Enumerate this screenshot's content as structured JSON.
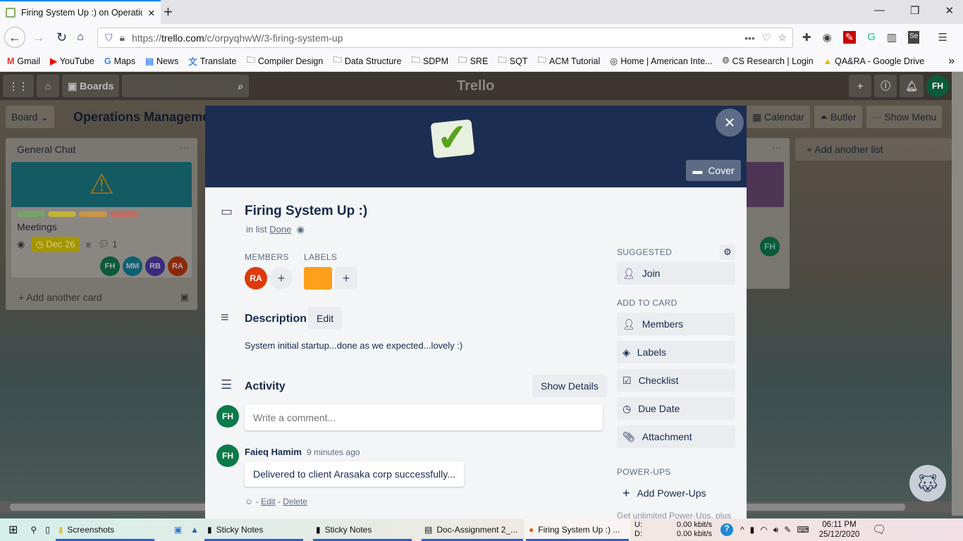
{
  "browser": {
    "tab_title": "Firing System Up :) on Operatio",
    "url_prefix": "https://",
    "url_domain": "trello.com",
    "url_path": "/c/orpyqhwW/3-firing-system-up",
    "bookmarks": [
      "Gmail",
      "YouTube",
      "Maps",
      "News",
      "Translate",
      "Compiler Design",
      "Data Structure",
      "SDPM",
      "SRE",
      "SQT",
      "ACM Tutorial",
      "Home | American Inte...",
      "CS Research | Login",
      "QA&RA - Google Drive"
    ]
  },
  "trello": {
    "boards_label": "Boards",
    "logo": "Trello",
    "user_initials": "FH",
    "board_view": "Board",
    "board_title": "Operations Manageme",
    "calendar": "Calendar",
    "butler": "Butler",
    "show_menu": "Show Menu",
    "add_list": "+ Add another list",
    "list": {
      "title": "General Chat",
      "card_title": "Meetings",
      "due": "Dec 26",
      "comments": "1",
      "members": [
        "FH",
        "MM",
        "RB",
        "RA"
      ],
      "add_card": "Add another card",
      "label_colors": [
        "#61bd4f",
        "#f2d600",
        "#ff9f1a",
        "#eb5a46"
      ]
    }
  },
  "card": {
    "cover_label": "Cover",
    "title": "Firing System Up :)",
    "in_list_prefix": "in list",
    "list_name": "Done",
    "members_heading": "MEMBERS",
    "labels_heading": "LABELS",
    "member": "RA",
    "label_color": "#ff9f1a",
    "description_heading": "Description",
    "edit_label": "Edit",
    "description": "System initial startup...done as we expected...lovely :)",
    "activity_heading": "Activity",
    "show_details": "Show Details",
    "comment_placeholder": "Write a comment...",
    "current_user": "FH",
    "activity": [
      {
        "initials": "FH",
        "author": "Faieq Hamim",
        "time": "9 minutes ago",
        "text": "Delivered to client Arasaka corp successfully...",
        "edit": "Edit",
        "delete": "Delete"
      }
    ],
    "suggested_heading": "SUGGESTED",
    "join": "Join",
    "add_to_card_heading": "ADD TO CARD",
    "add_to_card": [
      "Members",
      "Labels",
      "Checklist",
      "Due Date",
      "Attachment"
    ],
    "powerups_heading": "POWER-UPS",
    "add_powerups": "Add Power-Ups",
    "powerups_note": "Get unlimited Power-Ups, plus"
  },
  "taskbar": {
    "items": [
      "Screenshots",
      "Sticky Notes",
      "Sticky Notes",
      "Doc-Assignment 2_...",
      "Firing System Up :) ..."
    ],
    "net_up_label": "U:",
    "net_down_label": "D:",
    "net_up": "0.00 kbit/s",
    "net_down": "0.00 kbit/s",
    "time": "06:11 PM",
    "date": "25/12/2020"
  }
}
